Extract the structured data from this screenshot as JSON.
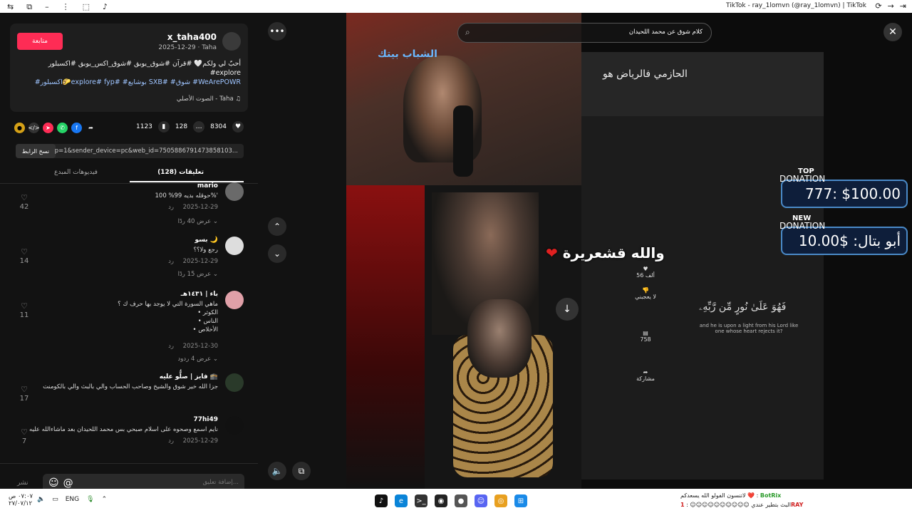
{
  "titlebar": {
    "title": "TikTok - ray_1lomvn (@ray_1lomvn) | TikTok"
  },
  "post": {
    "follow_label": "متابعة",
    "username": "x_taha400",
    "meta": "2025-12-29 · Taha",
    "desc_line1": "أحبّ لي ولكم🤍 #قرآن #شوق_يوبق #شوق_اكس_يوبق #اكسبلور #explore",
    "desc_line2": "#اكسبلور🌮explore# fyp# #بوشايع SXB# #شوق #WeArePOWR",
    "sound": "الصوت الأصلي - Taha"
  },
  "stats": {
    "likes": "8304",
    "comments": "128",
    "saves": "1123"
  },
  "link": {
    "copy_label": "نسخ الرابط",
    "url": "p=1&sender_device=pc&web_id=7505886791473858103..."
  },
  "tabs": {
    "comments": "(128) تعليقات",
    "creator": "فيديوهات المبدع"
  },
  "comments": [
    {
      "name": "mario",
      "text": "حوقله بديه 99% 100%'",
      "date": "2025-12-29",
      "reply": "رد",
      "more": "عرض 40 ردًا",
      "likes": "42"
    },
    {
      "name": "بسو 🌙",
      "text": "رجع ولا؟؟",
      "date": "2025-12-29",
      "reply": "رد",
      "more": "عرض 15 ردًا",
      "likes": "14"
    },
    {
      "name": "باء | ١٤٣١هـ",
      "text": "ماهي السورة التي لا يوجد بها حرف ك ؟",
      "list": [
        "• الكوثر",
        "• الناس",
        "• الأخلاص"
      ],
      "date": "2025-12-30",
      "reply": "رد",
      "more": "عرض 4 ردود",
      "likes": "11"
    },
    {
      "name": "فايز | صلُّو عليه 🕋",
      "text": "جزا الله خير شوق والشيخ وصاحب الحساب والي بالبث والي بالكومنت",
      "date": "",
      "reply": "",
      "more": "",
      "likes": "17"
    },
    {
      "name": "77hi49",
      "text": "نايم اسمع وصحوه على اسلام صبحي بس محمد اللحيدان بعد ماشاءالله عليه",
      "date": "2025-12-29",
      "reply": "رد",
      "more": "",
      "likes": "7"
    }
  ],
  "composer": {
    "placeholder": "إضافة تعليق...",
    "post_label": "نشر"
  },
  "video": {
    "search_value": "كلام شوق عن محمد اللحيدان",
    "logo_text": "الشباب بيتك",
    "banner": "الحازمي فالرياض هو",
    "caption": "والله قشعريرة",
    "quote_ar": "فَهُوَ عَلَىٰ نُورٍ مِّن رَّبِّهِۦ",
    "quote_en": "and he is upon a light from his Lord like one whose heart rejects it?",
    "side_likes": "56 ألف",
    "side_dislike": "لا يعجبني",
    "side_comments": "758",
    "side_share": "مشاركة"
  },
  "donations": {
    "top_label1": "TOP",
    "top_label2": "DONATION",
    "top_value": "777: $100.00",
    "new_label1": "NEW",
    "new_label2": "DONATION",
    "new_value": "أبو بتال: $10.00"
  },
  "taskbar": {
    "time": "٠٧:٠٧ ص",
    "date": "٢٧/٠٧/١٢",
    "lang": "ENG",
    "chat_line1_name": "BotRix",
    "chat_line1_text": "لاتنسون الفولو الله يسعدكم ❤️",
    "chat_line2_name": "1RAY",
    "chat_line2_text": "البث بتطير عندي ☺☺☺☺☺☺☺☺☺☺"
  }
}
